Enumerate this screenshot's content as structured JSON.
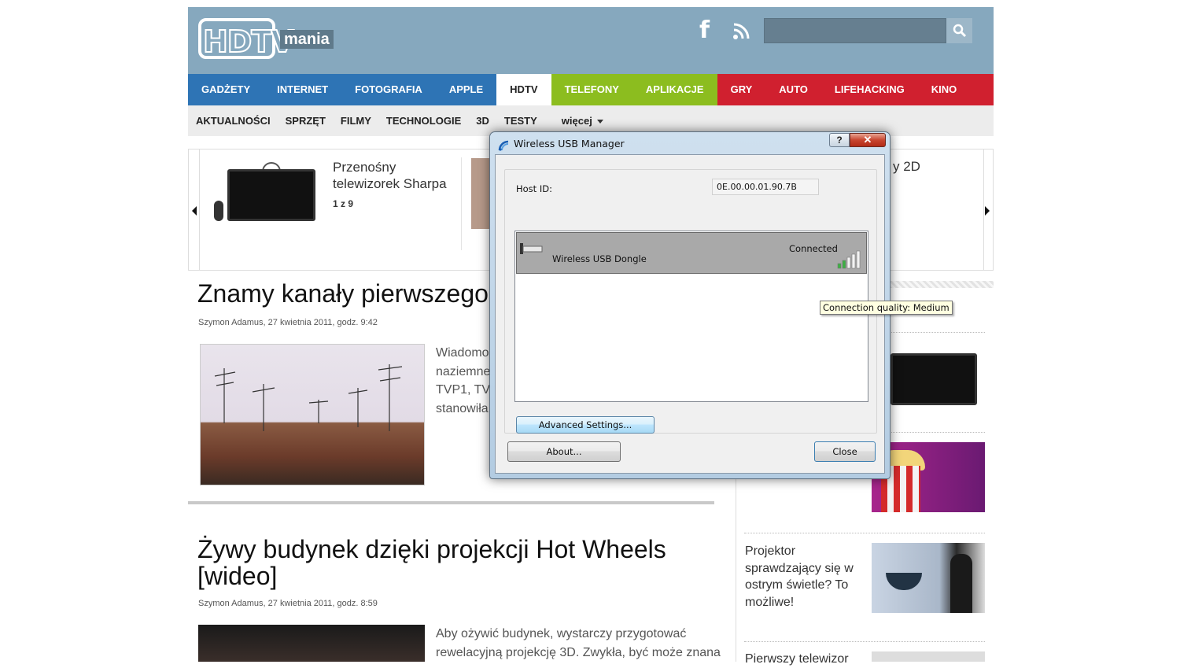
{
  "site": {
    "logo_text": "HDTV",
    "logo_suffix": "mania",
    "search": {
      "placeholder": ""
    },
    "icons": {
      "facebook": "facebook-icon",
      "rss": "rss-icon",
      "search": "search-icon"
    }
  },
  "nav": {
    "blue": [
      "GADŻETY",
      "INTERNET",
      "FOTOGRAFIA",
      "APPLE"
    ],
    "active": [
      "HDTV"
    ],
    "green": [
      "TELEFONY",
      "APLIKACJE"
    ],
    "red": [
      "GRY",
      "AUTO",
      "LIFEHACKING",
      "KINO"
    ],
    "colors": {
      "blue": "#2e74b5",
      "green": "#8cbd1f",
      "red": "#d0202f"
    }
  },
  "subnav": {
    "items": [
      "AKTUALNOŚCI",
      "SPRZĘT",
      "FILMY",
      "TECHNOLOGIE",
      "3D",
      "TESTY"
    ],
    "more": "więcej"
  },
  "slider": {
    "slide1_title": "Przenośny telewizorek Sharpa",
    "slide1_count": "1 z 9",
    "slide3_title": "y 2D"
  },
  "articles": [
    {
      "title": "Znamy kanały pierwszego",
      "meta": "Szymon Adamus, 27 kwietnia 2011, godz. 9:42",
      "excerpt": [
        "Wiadomo",
        "naziemne",
        "TVP1, TV",
        "stanowiła"
      ]
    },
    {
      "title_line1": "Żywy budynek dzięki projekcji Hot Wheels",
      "title_line2": "[wideo]",
      "meta": "Szymon Adamus, 27 kwietnia 2011, godz. 8:59",
      "excerpt": [
        "Aby ożywić budynek, wystarczy przygotować",
        "rewelacyjną projekcję 3D. Zwykła, być może znana"
      ]
    }
  ],
  "sidebar": {
    "item3_title": "Projektor sprawdzający się w ostrym świetle? To możliwe!",
    "item4_title": "Pierwszy telewizor"
  },
  "dialog": {
    "title": "Wireless USB Manager",
    "help_label": "?",
    "close_x_label": "✕",
    "host_label": "Host ID:",
    "host_value": "0E.00.00.01.90.7B",
    "device": {
      "name": "Wireless USB Dongle",
      "status": "Connected",
      "signal_bars_lit": 2,
      "signal_bars_total": 5
    },
    "tooltip": "Connection quality: Medium",
    "advanced_label": "Advanced Settings...",
    "about_label": "About...",
    "close_label": "Close"
  }
}
